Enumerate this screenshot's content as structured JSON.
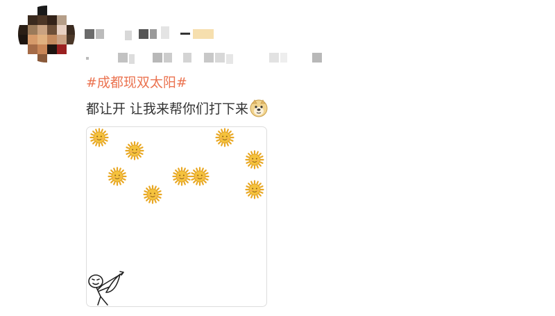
{
  "post": {
    "hashtag": "#成都现双太阳#",
    "text": "都让开 让我来帮你们打下来",
    "emoji_name": "doge-emoji"
  },
  "image": {
    "icon_sun": "sun-face-icon",
    "icon_archer": "archer-stickman-icon"
  },
  "colors": {
    "hashtag": "#eb7350",
    "text": "#333333",
    "sun_body": "#f5c23c",
    "sun_ray": "#e9a824"
  }
}
